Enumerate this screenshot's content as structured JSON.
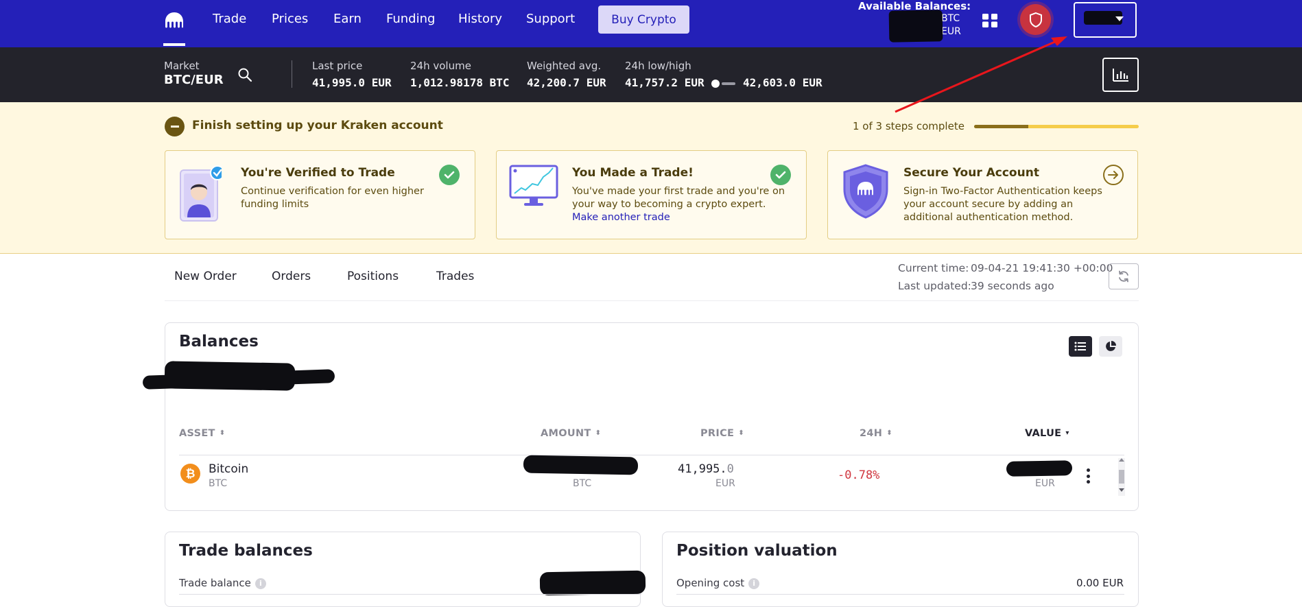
{
  "nav": {
    "items": [
      {
        "label": "Trade"
      },
      {
        "label": "Prices"
      },
      {
        "label": "Earn"
      },
      {
        "label": "Funding"
      },
      {
        "label": "History"
      },
      {
        "label": "Support"
      }
    ],
    "buy_label": "Buy Crypto",
    "available_title": "Available Balances:",
    "available_btc": "BTC",
    "available_eur": "EUR"
  },
  "market": {
    "market_label": "Market",
    "pair": "BTC/EUR",
    "last_price_label": "Last price",
    "last_price_value": "41,995.0 EUR",
    "volume_label": "24h volume",
    "volume_value": "1,012.98178 BTC",
    "wavg_label": "Weighted avg.",
    "wavg_value": "42,200.7 EUR",
    "lowhigh_label": "24h low/high",
    "low_value": "41,757.2 EUR",
    "high_value": "42,603.0 EUR"
  },
  "setup": {
    "title": "Finish setting up your Kraken account",
    "steps_text": "1 of 3 steps complete",
    "steps_fraction": 0.33,
    "cards": [
      {
        "title": "You're Verified to Trade",
        "desc": "Continue verification for even higher funding limits",
        "status": "complete"
      },
      {
        "title": "You Made a Trade!",
        "desc": "You've made your first trade and you're on your way to becoming a crypto expert.",
        "link": "Make another trade",
        "status": "complete"
      },
      {
        "title": "Secure Your Account",
        "desc": "Sign-in Two-Factor Authentication keeps your account secure by adding an additional authentication method.",
        "status": "todo"
      }
    ]
  },
  "tabs": {
    "items": [
      {
        "label": "New Order"
      },
      {
        "label": "Orders"
      },
      {
        "label": "Positions"
      },
      {
        "label": "Trades"
      }
    ],
    "current_time_label": "Current time:",
    "current_time_value": "09-04-21 19:41:30 +00:00",
    "last_updated_label": "Last updated:",
    "last_updated_value": "39 seconds ago"
  },
  "balances": {
    "title": "Balances",
    "columns": {
      "asset": "ASSET",
      "amount": "AMOUNT",
      "price": "PRICE",
      "change": "24H",
      "value": "VALUE"
    },
    "rows": [
      {
        "name": "Bitcoin",
        "symbol": "BTC",
        "amount_unit": "BTC",
        "price_main": "41,995.",
        "price_decimal": "0",
        "price_unit": "EUR",
        "change": "-0.78%",
        "value_unit": "EUR"
      }
    ]
  },
  "trade_balances": {
    "title": "Trade balances",
    "rows": [
      {
        "label": "Trade balance"
      }
    ]
  },
  "position_valuation": {
    "title": "Position valuation",
    "rows": [
      {
        "label": "Opening cost",
        "value": "0.00 EUR"
      }
    ]
  },
  "colors": {
    "brand": "#2420b8",
    "market_bar": "#23232b",
    "banner_bg": "#fff8e0",
    "negative": "#d0363f",
    "complete": "#4fb36a",
    "bitcoin": "#f28e1c"
  },
  "icons": {
    "logo": "kraken-logo-icon",
    "apps": "grid-icon",
    "security": "shield-icon",
    "search": "search-icon",
    "chart": "bar-chart-icon",
    "refresh": "refresh-icon",
    "list_view": "list-icon",
    "pie_view": "pie-chart-icon"
  }
}
